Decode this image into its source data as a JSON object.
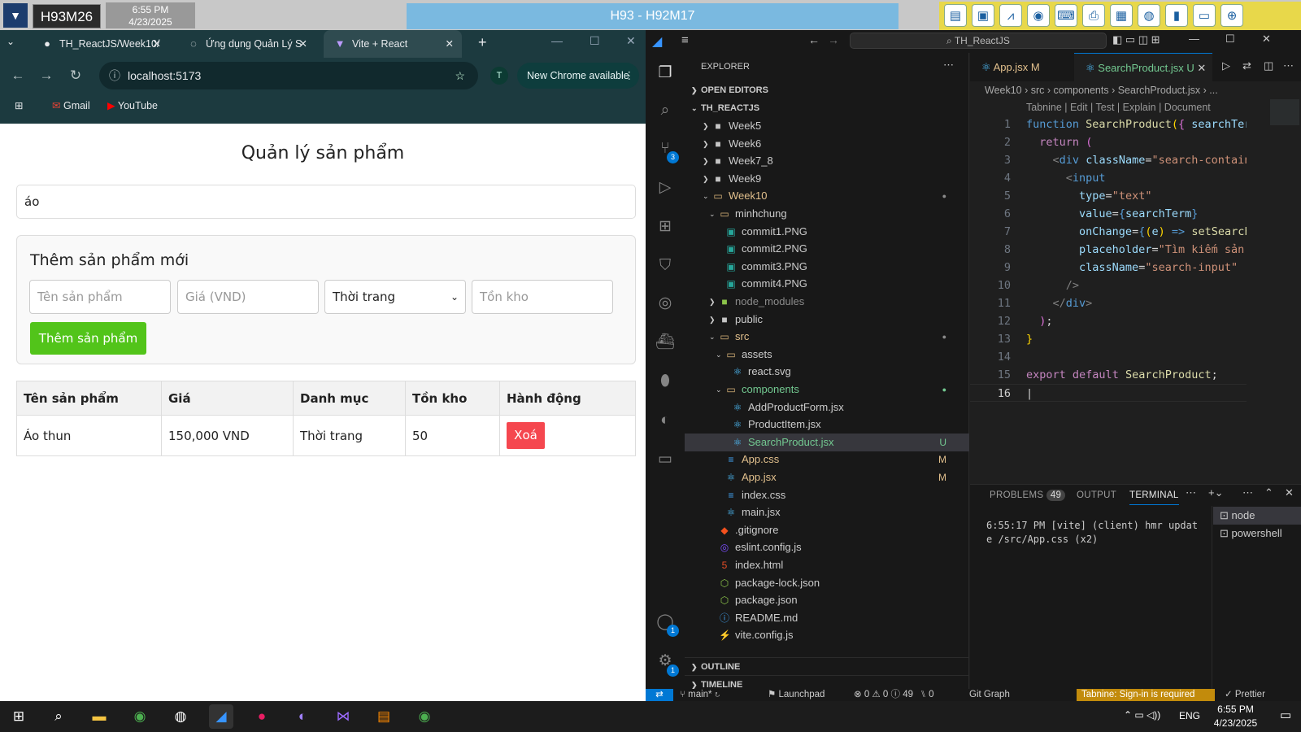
{
  "remote": {
    "host": "H93M26",
    "time": "6:55 PM",
    "date": "4/23/2025",
    "session": "H93 - H92M17"
  },
  "chrome": {
    "tabs": [
      {
        "label": "TH_ReactJS/Week10/"
      },
      {
        "label": "Ứng dụng Quản Lý S"
      },
      {
        "label": "Vite + React"
      }
    ],
    "url": "localhost:5173",
    "new_chrome": "New Chrome available",
    "profile": "T",
    "bookmarks": [
      {
        "label": "Gmail"
      },
      {
        "label": "YouTube"
      }
    ]
  },
  "app": {
    "title": "Quản lý sản phẩm",
    "search_value": "áo",
    "form_title": "Thêm sản phẩm mới",
    "name_ph": "Tên sản phẩm",
    "price_ph": "Giá (VND)",
    "category": "Thời trang",
    "stock_ph": "Tồn kho",
    "add_button": "Thêm sản phẩm",
    "headers": [
      "Tên sản phẩm",
      "Giá",
      "Danh mục",
      "Tồn kho",
      "Hành động"
    ],
    "rows": [
      {
        "name": "Áo thun",
        "price": "150,000 VND",
        "category": "Thời trang",
        "stock": "50",
        "action": "Xoá"
      }
    ]
  },
  "vscode": {
    "command_center": "TH_ReactJS",
    "explorer_title": "EXPLORER",
    "open_editors": "OPEN EDITORS",
    "root": "TH_REACTJS",
    "tree": [
      {
        "label": "Week5"
      },
      {
        "label": "Week6"
      },
      {
        "label": "Week7_8"
      },
      {
        "label": "Week9"
      },
      {
        "label": "Week10"
      },
      {
        "label": "minhchung"
      },
      {
        "label": "commit1.PNG"
      },
      {
        "label": "commit2.PNG"
      },
      {
        "label": "commit3.PNG"
      },
      {
        "label": "commit4.PNG"
      },
      {
        "label": "node_modules"
      },
      {
        "label": "public"
      },
      {
        "label": "src"
      },
      {
        "label": "assets"
      },
      {
        "label": "react.svg"
      },
      {
        "label": "components"
      },
      {
        "label": "AddProductForm.jsx"
      },
      {
        "label": "ProductItem.jsx"
      },
      {
        "label": "SearchProduct.jsx",
        "status": "U"
      },
      {
        "label": "App.css",
        "status": "M"
      },
      {
        "label": "App.jsx",
        "status": "M"
      },
      {
        "label": "index.css"
      },
      {
        "label": "main.jsx"
      },
      {
        "label": ".gitignore"
      },
      {
        "label": "eslint.config.js"
      },
      {
        "label": "index.html"
      },
      {
        "label": "package-lock.json"
      },
      {
        "label": "package.json"
      },
      {
        "label": "README.md"
      },
      {
        "label": "vite.config.js"
      }
    ],
    "outline": "OUTLINE",
    "timeline": "TIMELINE",
    "editor_tabs": [
      {
        "label": "App.jsx",
        "status": "M"
      },
      {
        "label": "SearchProduct.jsx",
        "status": "U"
      }
    ],
    "breadcrumb": "Week10 › src › components › SearchProduct.jsx › ...",
    "tabnine": "Tabnine | Edit | Test | Explain | Document",
    "line_numbers": [
      "1",
      "2",
      "3",
      "4",
      "5",
      "6",
      "7",
      "8",
      "9",
      "10",
      "11",
      "12",
      "13",
      "14",
      "15",
      "16"
    ],
    "panel_tabs": {
      "problems": "PROBLEMS",
      "problems_count": "49",
      "output": "OUTPUT",
      "terminal": "TERMINAL"
    },
    "terminal_text": "6:55:17 PM [vite] (client) hmr update /src/App.css (x2)",
    "terminals": [
      {
        "label": "node"
      },
      {
        "label": "powershell"
      }
    ],
    "badges": {
      "scm": "3",
      "accounts": "1",
      "manage": "1"
    },
    "status": {
      "branch": "main*",
      "launchpad": "Launchpad",
      "problems": "⊗ 0 ⚠ 0 ⓘ 49",
      "ports": "0",
      "git_graph": "Git Graph",
      "tabnine": "Tabnine: Sign-in is required",
      "prettier": "Prettier"
    }
  },
  "taskbar": {
    "lang": "ENG",
    "time": "6:55 PM",
    "date": "4/23/2025"
  }
}
